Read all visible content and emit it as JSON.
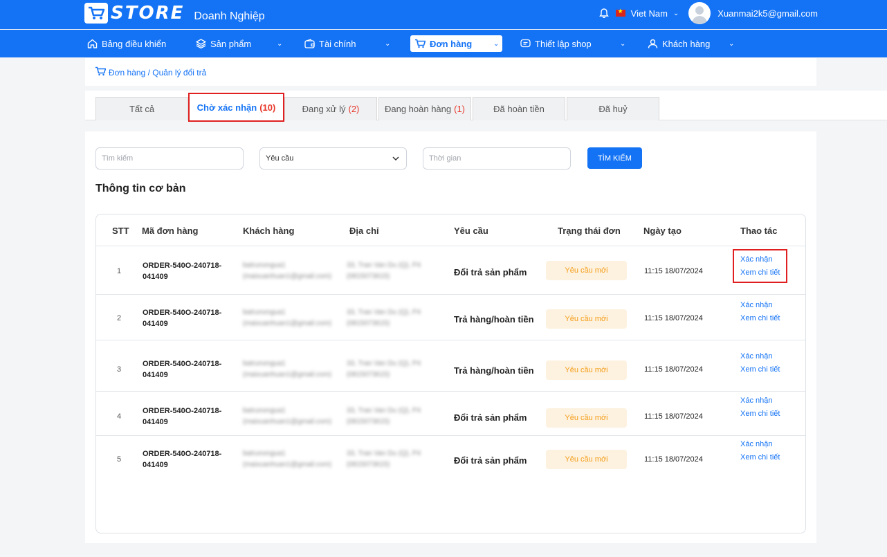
{
  "app": {
    "logo_text": "STORE",
    "subtitle": "Doanh Nghiệp",
    "language": "Viet Nam",
    "user_email": "Xuanmai2k5@gmail.com"
  },
  "nav": {
    "items": [
      {
        "label": "Bảng điều khiển",
        "icon": "home-icon"
      },
      {
        "label": "Sản phẩm",
        "icon": "layers-icon"
      },
      {
        "label": "Tài chính",
        "icon": "wallet-icon"
      },
      {
        "label": "Đơn hàng",
        "icon": "cart-icon"
      },
      {
        "label": "Thiết lập shop",
        "icon": "chat-icon"
      },
      {
        "label": "Khách hàng",
        "icon": "user-icon"
      }
    ],
    "active": "Đơn hàng"
  },
  "breadcrumb": "Đơn hàng / Quản lý đổi trả",
  "tabs": [
    {
      "label": "Tất cả",
      "count": ""
    },
    {
      "label": "Chờ xác nhận",
      "count": "(10)"
    },
    {
      "label": "Đang xử lý",
      "count": "(2)"
    },
    {
      "label": "Đang hoàn hàng",
      "count": "(1)"
    },
    {
      "label": "Đã hoàn tiền",
      "count": ""
    },
    {
      "label": "Đã huỷ",
      "count": ""
    }
  ],
  "filters": {
    "search_placeholder": "Tìm kiếm",
    "request_value": "Yêu cầu",
    "time_placeholder": "Thời gian",
    "search_button": "TÌM KIẾM"
  },
  "section_title": "Thông tin cơ bản",
  "table": {
    "headers": [
      "STT",
      "Mã đơn hàng",
      "Khách hàng",
      "Địa chỉ",
      "Yêu cầu",
      "Trạng thái đơn",
      "Ngày tạo",
      "Thao tác"
    ],
    "rows": [
      {
        "stt": "1",
        "code1": "ORDER-540O-240718-",
        "code2": "041409",
        "cust1": "batrunongua1",
        "cust2": "(maixuanhuan1@gmail.com)",
        "addr1": "33, Tran Van Du (Q), P4",
        "addr2": "(0815073615)",
        "request": "Đổi trả sản phẩm",
        "status": "Yêu cầu mới",
        "date": "11:15 18/07/2024",
        "action1": "Xác nhận",
        "action2": "Xem chi tiết"
      },
      {
        "stt": "2",
        "code1": "ORDER-540O-240718-",
        "code2": "041409",
        "cust1": "batrunongua1",
        "cust2": "(maixuanhuan1@gmail.com)",
        "addr1": "33, Tran Van Du (Q), P4",
        "addr2": "(0815073615)",
        "request": "Trả hàng/hoàn tiền",
        "status": "Yêu cầu mới",
        "date": "11:15 18/07/2024",
        "action1": "Xác nhận",
        "action2": "Xem chi tiết"
      },
      {
        "stt": "3",
        "code1": "ORDER-540O-240718-",
        "code2": "041409",
        "cust1": "batrunongua1",
        "cust2": "(maixuanhuan1@gmail.com)",
        "addr1": "33, Tran Van Du (Q), P4",
        "addr2": "(0815073615)",
        "request": "Trả hàng/hoàn tiền",
        "status": "Yêu cầu mới",
        "date": "11:15 18/07/2024",
        "action1": "Xác nhận",
        "action2": "Xem chi tiết"
      },
      {
        "stt": "4",
        "code1": "ORDER-540O-240718-",
        "code2": "041409",
        "cust1": "batrunongua1",
        "cust2": "(maixuanhuan1@gmail.com)",
        "addr1": "33, Tran Van Du (Q), P4",
        "addr2": "(0815073615)",
        "request": "Đổi trả sản phẩm",
        "status": "Yêu cầu mới",
        "date": "11:15 18/07/2024",
        "action1": "Xác nhận",
        "action2": "Xem chi tiết"
      },
      {
        "stt": "5",
        "code1": "ORDER-540O-240718-",
        "code2": "041409",
        "cust1": "batrunongua1",
        "cust2": "(maixuanhuan1@gmail.com)",
        "addr1": "33, Tran Van Du (Q), P4",
        "addr2": "(0815073615)",
        "request": "Đổi trả sản phẩm",
        "status": "Yêu cầu mới",
        "date": "11:15 18/07/2024",
        "action1": "Xác nhận",
        "action2": "Xem chi tiết"
      }
    ]
  },
  "colors": {
    "primary": "#1473f5",
    "badge_bg": "#fdf1df",
    "badge_text": "#f59f1a",
    "count_red": "#e8372a",
    "highlight": "#e02020"
  }
}
